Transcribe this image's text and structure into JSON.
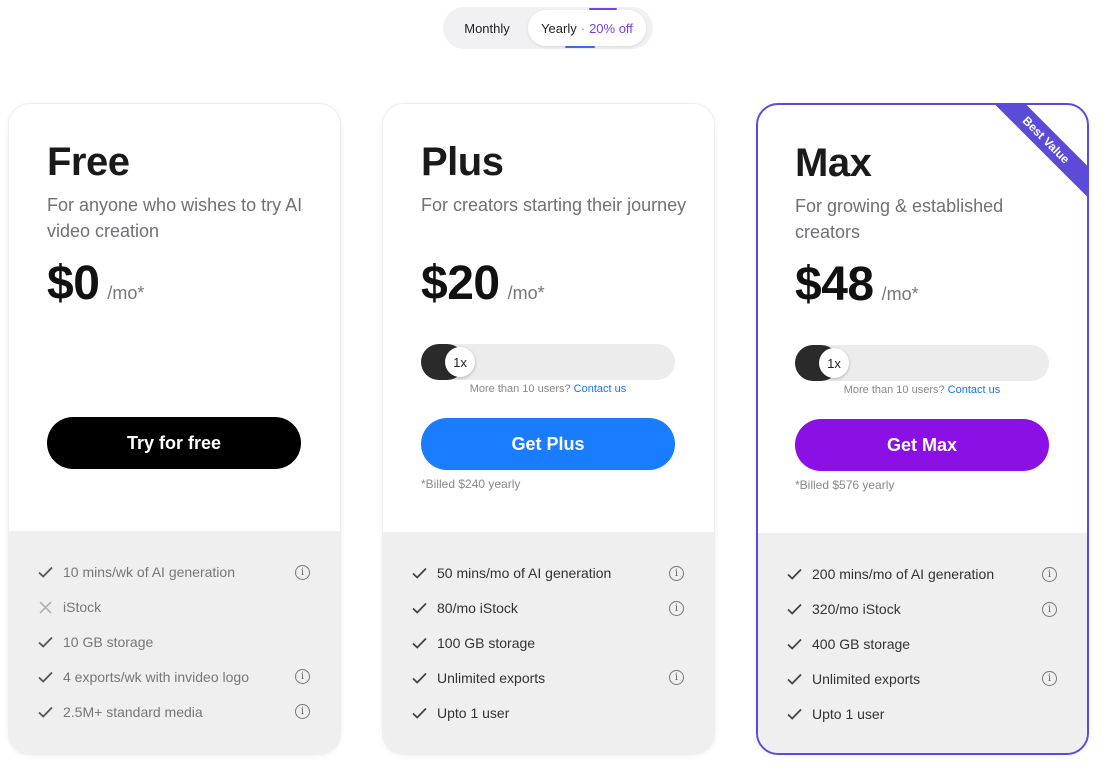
{
  "billing": {
    "monthly_label": "Monthly",
    "yearly_label": "Yearly",
    "discount_sep": "·",
    "discount_label": "20% off",
    "selected": "Yearly"
  },
  "colors": {
    "plus_cta": "#1a7cff",
    "max_cta": "#8a10e6",
    "free_cta": "#000000",
    "max_border": "#5b4bd6",
    "link": "#1a73e8"
  },
  "plans": [
    {
      "name": "Free",
      "description": "For anyone who wishes to try AI video creation",
      "price": "$0",
      "per": "/mo*",
      "cta": "Try for free",
      "features": [
        {
          "text": "10 mins/wk of AI generation",
          "icon": "check-icon",
          "info": true
        },
        {
          "text": "iStock",
          "icon": "cross-icon",
          "info": false
        },
        {
          "text": "10 GB storage",
          "icon": "check-icon",
          "info": false
        },
        {
          "text": "4 exports/wk with invideo logo",
          "icon": "check-icon",
          "info": true
        },
        {
          "text": "2.5M+ standard media",
          "icon": "check-icon",
          "info": true
        }
      ]
    },
    {
      "name": "Plus",
      "description": "For creators starting their journey",
      "price": "$20",
      "per": "/mo*",
      "slider_value": "1x",
      "contact_text": "More than 10 users?",
      "contact_link": "Contact us",
      "cta": "Get Plus",
      "billed": "*Billed $240 yearly",
      "features": [
        {
          "text": "50 mins/mo of AI generation",
          "icon": "check-icon",
          "info": true
        },
        {
          "text": "80/mo iStock",
          "icon": "check-icon",
          "info": true
        },
        {
          "text": "100 GB storage",
          "icon": "check-icon",
          "info": false
        },
        {
          "text": "Unlimited exports",
          "icon": "check-icon",
          "info": true
        },
        {
          "text": "Upto 1 user",
          "icon": "check-icon",
          "info": false
        }
      ]
    },
    {
      "name": "Max",
      "description": "For growing & established creators",
      "price": "$48",
      "per": "/mo*",
      "badge": "Best Value",
      "slider_value": "1x",
      "contact_text": "More than 10 users?",
      "contact_link": "Contact us",
      "cta": "Get Max",
      "billed": "*Billed $576 yearly",
      "features": [
        {
          "text": "200 mins/mo of AI generation",
          "icon": "check-icon",
          "info": true
        },
        {
          "text": "320/mo iStock",
          "icon": "check-icon",
          "info": true
        },
        {
          "text": "400 GB storage",
          "icon": "check-icon",
          "info": false
        },
        {
          "text": "Unlimited exports",
          "icon": "check-icon",
          "info": true
        },
        {
          "text": "Upto 1 user",
          "icon": "check-icon",
          "info": false
        }
      ]
    }
  ]
}
